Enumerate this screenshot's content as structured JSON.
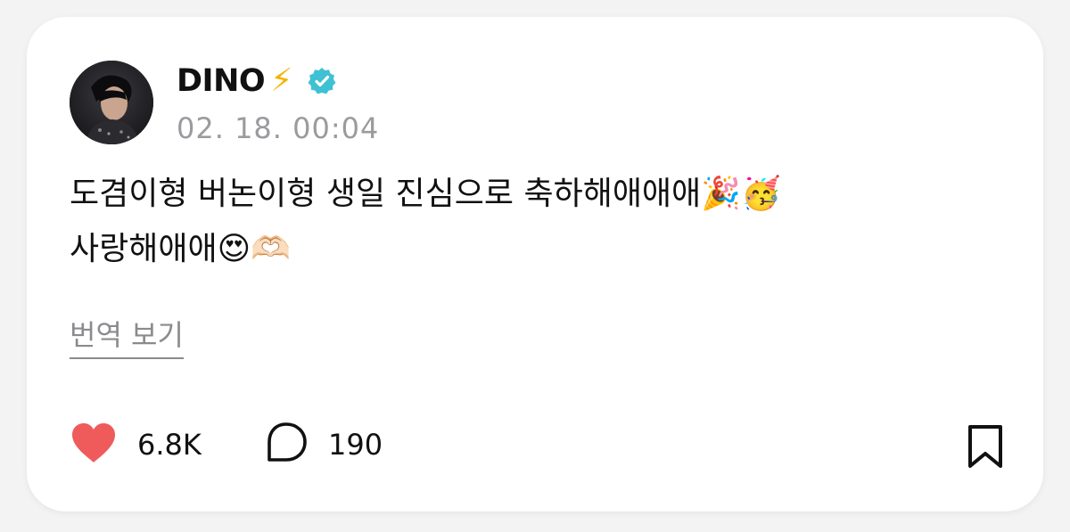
{
  "post": {
    "author": "DINO",
    "author_badge_emoji": "⚡",
    "verified_icon": "verified-check-icon",
    "timestamp": "02. 18. 00:04",
    "text": "도겸이형 버논이형 생일 진심으로 축하해애애애🎉🥳\n사랑해애애😍🫶🏻",
    "translate_label": "번역 보기"
  },
  "actions": {
    "likes": "6.8K",
    "comments": "190",
    "like_icon": "heart-icon",
    "comment_icon": "comment-icon",
    "bookmark_icon": "bookmark-icon"
  },
  "colors": {
    "heart": "#ef5b5b",
    "verified": "#3fc1d3",
    "muted_text": "#9b9b9f",
    "text": "#111111"
  }
}
